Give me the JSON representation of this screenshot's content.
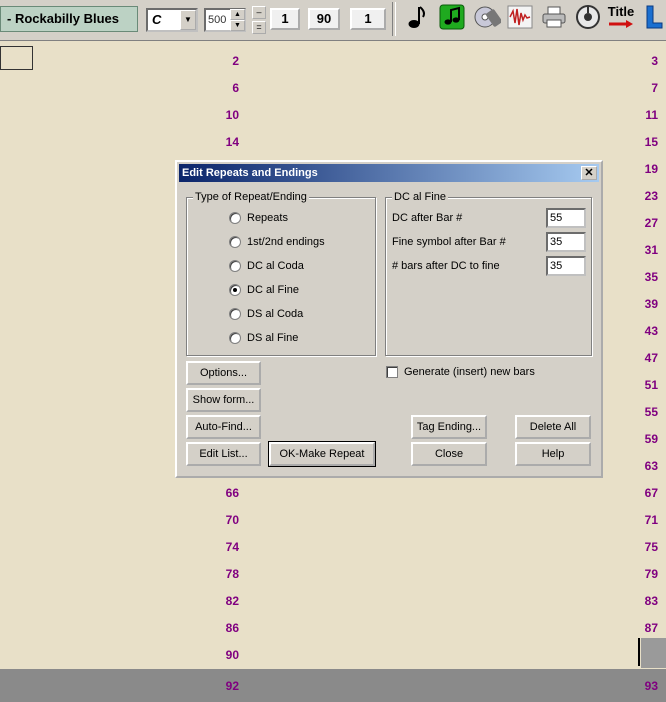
{
  "toolbar": {
    "song_title": "- Rockabilly Blues",
    "key": "C",
    "tempo": "500",
    "num1": "1",
    "num2": "90",
    "num3": "1",
    "title_icon_label": "Title",
    "icons": [
      "note-icon",
      "green-note-icon",
      "cd-icon",
      "audio-wave-icon",
      "printer-icon",
      "disc-drum-icon",
      "title-icon",
      "L-icon"
    ]
  },
  "sheet": {
    "bars": [
      {
        "left": "2",
        "right": "3"
      },
      {
        "left": "6",
        "right": "7"
      },
      {
        "left": "10",
        "right": "11"
      },
      {
        "left": "14",
        "right": "15"
      },
      {
        "left": "",
        "right": "19"
      },
      {
        "left": "",
        "right": "23"
      },
      {
        "left": "",
        "right": "27"
      },
      {
        "left": "",
        "right": "31"
      },
      {
        "left": "",
        "right": "35"
      },
      {
        "left": "",
        "right": "39"
      },
      {
        "left": "",
        "right": "43"
      },
      {
        "left": "",
        "right": "47"
      },
      {
        "left": "",
        "right": "51"
      },
      {
        "left": "",
        "right": "55"
      },
      {
        "left": "",
        "right": "59"
      },
      {
        "left": "",
        "right": "63"
      },
      {
        "left": "66",
        "right": "67"
      },
      {
        "left": "70",
        "right": "71"
      },
      {
        "left": "74",
        "right": "75"
      },
      {
        "left": "78",
        "right": "79"
      },
      {
        "left": "82",
        "right": "83"
      },
      {
        "left": "86",
        "right": "87"
      },
      {
        "left": "90",
        "right": ""
      },
      {
        "left": "92",
        "right": "93"
      }
    ],
    "bar_color": "#800080"
  },
  "dialog": {
    "title": "Edit Repeats and Endings",
    "type_group_label": "Type of Repeat/Ending",
    "options": [
      {
        "label": "Repeats",
        "selected": false
      },
      {
        "label": "1st/2nd endings",
        "selected": false
      },
      {
        "label": "DC al Coda",
        "selected": false
      },
      {
        "label": "DC al Fine",
        "selected": true
      },
      {
        "label": "DS al Coda",
        "selected": false
      },
      {
        "label": "DS al Fine",
        "selected": false
      }
    ],
    "dc_group_label": "DC al Fine",
    "fields": [
      {
        "label": "DC after Bar #",
        "value": "55"
      },
      {
        "label": "Fine symbol after Bar #",
        "value": "35"
      },
      {
        "label": "# bars after DC to fine",
        "value": "35"
      }
    ],
    "generate_label": "Generate (insert) new bars",
    "buttons": {
      "options": "Options...",
      "show_form": "Show form...",
      "auto_find": "Auto-Find...",
      "edit_list": "Edit List...",
      "ok_make_repeat": "OK-Make Repeat",
      "tag_ending": "Tag Ending...",
      "delete_all": "Delete All",
      "close": "Close",
      "help": "Help"
    }
  }
}
